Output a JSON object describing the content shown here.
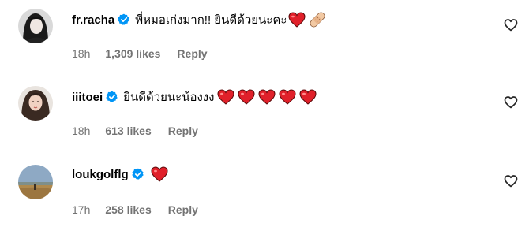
{
  "comments": [
    {
      "username": "fr.racha",
      "text": "พี่หมอเก่งมาก!! ยินดีด้วยนะคะ",
      "emojis": [
        "red-heart",
        "adhesive-bandage"
      ],
      "time": "18h",
      "likes": "1,309 likes",
      "reply": "Reply"
    },
    {
      "username": "iiitoei",
      "text": "ยินดีด้วยนะน้องงง",
      "emojis": [
        "red-heart",
        "red-heart",
        "red-heart",
        "red-heart",
        "red-heart"
      ],
      "time": "18h",
      "likes": "613 likes",
      "reply": "Reply"
    },
    {
      "username": "loukgolflg",
      "text": "",
      "emojis": [
        "red-heart"
      ],
      "time": "17h",
      "likes": "258 likes",
      "reply": "Reply"
    }
  ],
  "colors": {
    "verified": "#0095f6",
    "heart": "#e0202a",
    "meta_text": "#737373"
  }
}
